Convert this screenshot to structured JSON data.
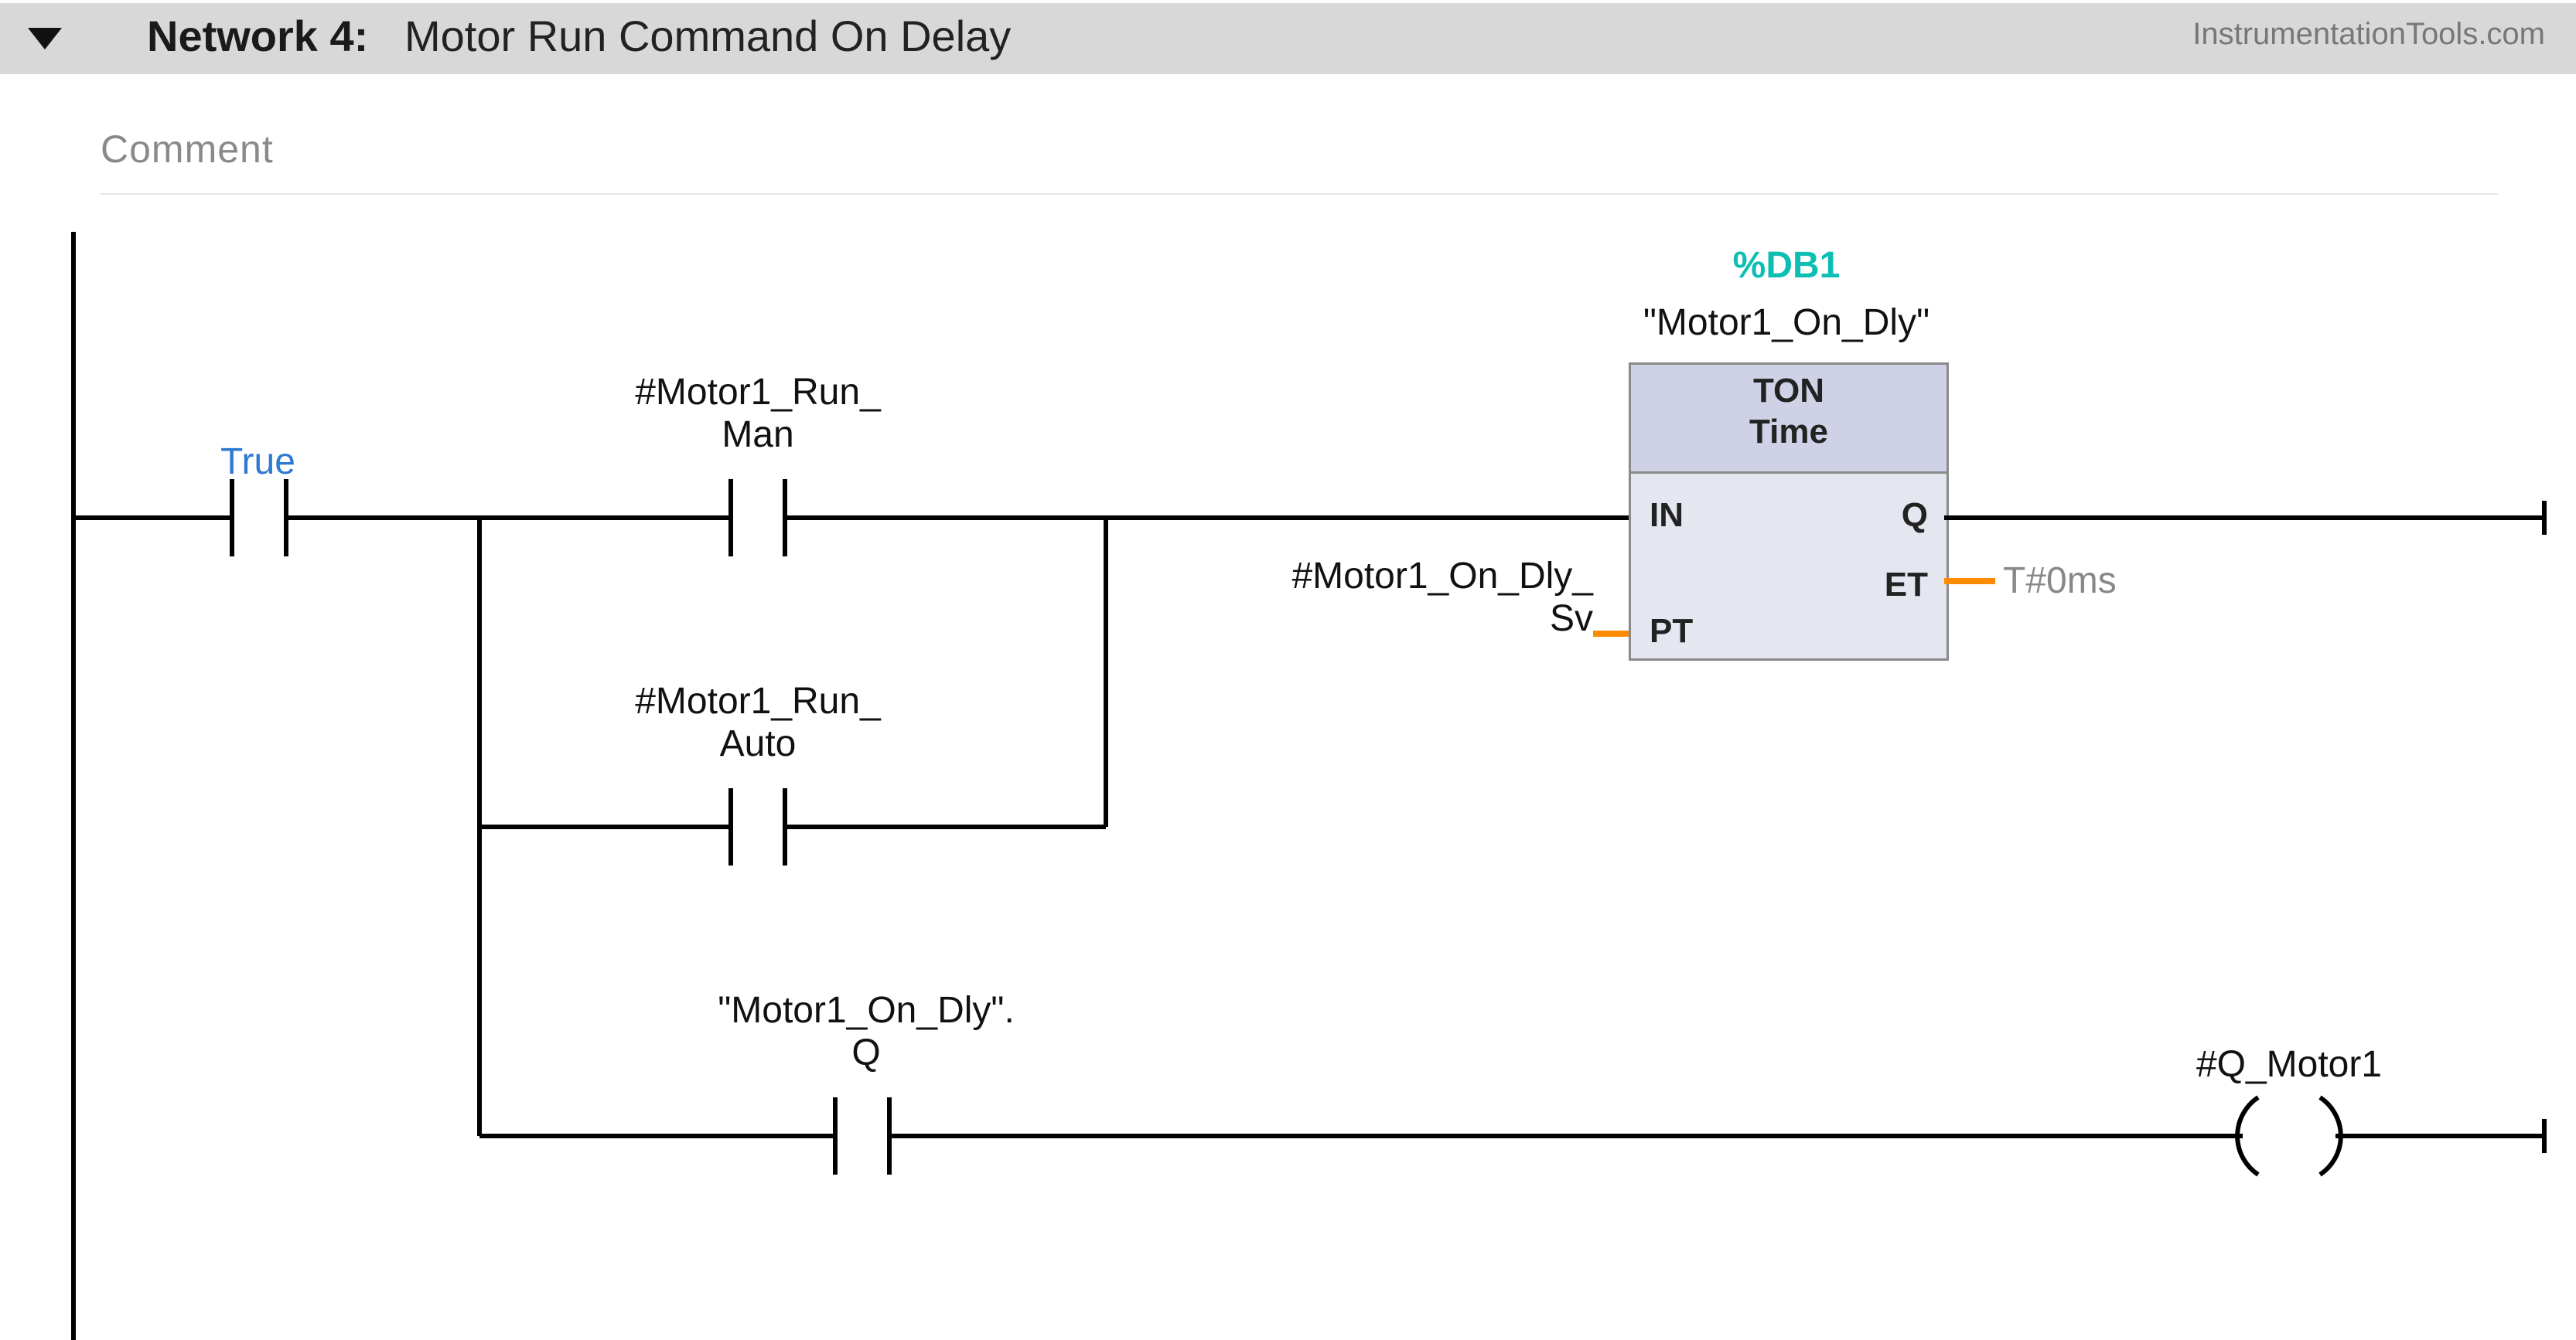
{
  "header": {
    "network_label": "Network 4:",
    "network_title": "Motor Run Command On Delay",
    "watermark": "InstrumentationTools.com"
  },
  "comment_placeholder": "Comment",
  "contacts": {
    "true_label": "True",
    "run_man_label": "#Motor1_Run_\nMan",
    "run_auto_label": "#Motor1_Run_\nAuto",
    "on_dly_q_label": "\"Motor1_On_Dly\".\nQ"
  },
  "timer": {
    "db_address": "%DB1",
    "db_name": "\"Motor1_On_Dly\"",
    "type": "TON",
    "subtype": "Time",
    "ports": {
      "in": "IN",
      "q": "Q",
      "pt": "PT",
      "et": "ET"
    },
    "pt_value": "#Motor1_On_Dly_\nSv",
    "et_value": "T#0ms"
  },
  "coil": {
    "q_motor1_label": "#Q_Motor1"
  }
}
